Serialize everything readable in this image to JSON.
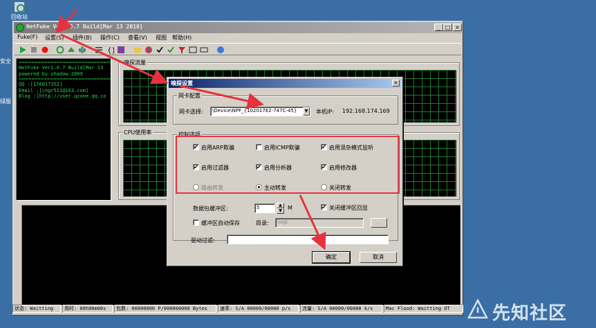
{
  "desktop": {
    "recycle_label": "回收站",
    "side_label_1": "安全",
    "side_label_2": "绿服"
  },
  "window": {
    "title": "NetFuke Ver1.0.7 Build[Mar 13 2010]",
    "menu": [
      "Fuke(F)",
      "设置(S)",
      "插件(B)",
      "操作(C)",
      "查看(V)",
      "视图",
      "帮助(H)"
    ],
    "caption_min": "_",
    "caption_max": "□",
    "caption_close": "×"
  },
  "console": {
    "lines": [
      "NetFuke Ver1.0.7 Build[Mar 13",
      "powered by shadow 2009",
      "",
      "QQ    :[176017352]",
      "Email :[cngr521@163.com]",
      "Blog  :[http://user.qzone.qq.co"
    ],
    "separator": "=========================================="
  },
  "panels": {
    "sniff_traffic": "嗅探流量",
    "cpu_usage": "CPU使用率"
  },
  "status": {
    "state": "状态: Waitting",
    "elapsed": "用时: 00h00m00s",
    "packets": "包数: 00000000 P/000000000 Bytes",
    "rate": "速率: S/A 00000/00000 p/s",
    "traffic": "流量: S/A 00000/00000 k/s",
    "mac_flood": "Mac Flood: Waitting OT"
  },
  "dialog": {
    "title": "嗅探设置",
    "close": "×",
    "nic_group": "网卡配置",
    "nic_select_label": "网卡选择:",
    "nic_value": "\\Device\\NPF_{102017E2-747C-45}",
    "local_ip_label": "本机IP:",
    "local_ip": "192.168.174.169",
    "control_group": "控制选项",
    "options": [
      {
        "label": "启用ARP欺骗",
        "checked": true
      },
      {
        "label": "启用ICMP欺骗",
        "checked": false
      },
      {
        "label": "启用混杂模式监听",
        "checked": true
      },
      {
        "label": "启用过滤器",
        "checked": true
      },
      {
        "label": "启用分析器",
        "checked": true
      },
      {
        "label": "启用修改器",
        "checked": true
      }
    ],
    "radios": [
      {
        "label": "路由转发",
        "selected": false,
        "disabled": true
      },
      {
        "label": "主动转发",
        "selected": true,
        "disabled": false
      },
      {
        "label": "关闭转发",
        "selected": false,
        "disabled": false
      }
    ],
    "buffer_label": "数据包缓冲区:",
    "buffer_value": "5",
    "buffer_unit": "M",
    "close_buffer_label": "关闭缓冲区回显",
    "close_buffer_checked": true,
    "autosave_label": "缓冲区自动保存",
    "autosave_checked": false,
    "dir_label": "目录:",
    "dir_value": "\\log\\",
    "browse": "...",
    "driver_filter_label": "驱动过滤:",
    "driver_filter_value": "",
    "ok": "确定",
    "cancel": "取消"
  },
  "watermark": {
    "text": "先知社区"
  },
  "colors": {
    "desktop": "#3a6ea5",
    "annotation": "#e5323e",
    "console_text": "#2fd44a",
    "dialog_title": "#0a246a"
  }
}
